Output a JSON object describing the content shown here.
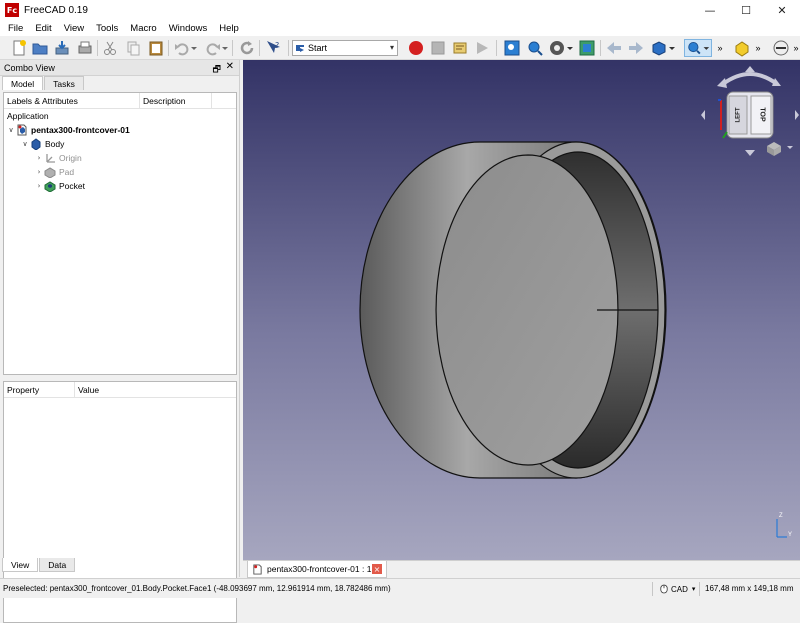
{
  "window": {
    "title": "FreeCAD 0.19",
    "logo": "Fc",
    "minimize": "—",
    "maximize": "☐",
    "close": "✕"
  },
  "menu": [
    "File",
    "Edit",
    "View",
    "Tools",
    "Macro",
    "Windows",
    "Help"
  ],
  "toolbar": {
    "workbench_selected": "Start"
  },
  "combo_view": {
    "title": "Combo View",
    "pin": "🗗",
    "close": "✕",
    "tabs": [
      "Model",
      "Tasks"
    ],
    "tree": {
      "col_labels": "Labels & Attributes",
      "col_description": "Description",
      "group": "Application",
      "items": [
        {
          "label": "pentax300-frontcover-01",
          "arrow": "∨",
          "icon": "document-icon"
        },
        {
          "label": "Body",
          "arrow": "∨",
          "icon": "body-icon"
        },
        {
          "label": "Origin",
          "arrow": "›",
          "icon": "origin-icon"
        },
        {
          "label": "Pad",
          "arrow": "›",
          "icon": "pad-icon"
        },
        {
          "label": "Pocket",
          "arrow": "›",
          "icon": "pocket-icon"
        }
      ]
    },
    "properties": {
      "col_property": "Property",
      "col_value": "Value"
    },
    "bottom_tabs": [
      "View",
      "Data"
    ]
  },
  "viewport": {
    "navcube_face_front": "LEFT",
    "navcube_face_top": "TOP",
    "axis_z": "Z",
    "axis_y": "Y"
  },
  "document_tab": {
    "label": "pentax300-frontcover-01 : 1",
    "close": "×"
  },
  "statusbar": {
    "message": "Preselected: pentax300_frontcover_01.Body.Pocket.Face1 (-48.093697 mm, 12.961914 mm, 18.782486 mm)",
    "nav_style": "CAD",
    "dimensions": "167,48 mm x 149,18 mm"
  },
  "colors": {
    "view_top": "#333366",
    "view_bottom": "#a6a6bf",
    "record_red": "#d42020"
  }
}
